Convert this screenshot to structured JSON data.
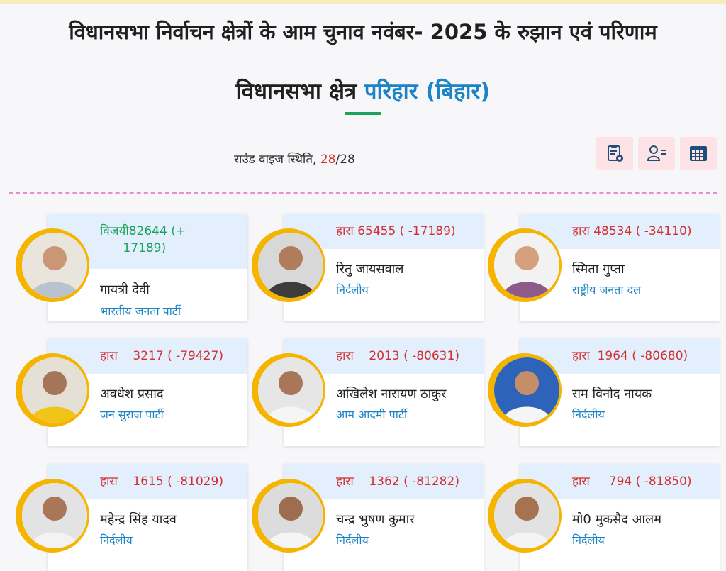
{
  "header": {
    "title": "विधानसभा निर्वाचन क्षेत्रों के आम चुनाव नवंबर- 2025 के रुझान एवं परिणाम",
    "subtitle_prefix": "विधानसभा क्षेत्र ",
    "constituency": "परिहार",
    "state": "(बिहार)"
  },
  "round": {
    "label": "राउंड वाइज स्थिति, ",
    "current": "28",
    "total": "/28"
  },
  "toolbar": {
    "icons": [
      "clipboard-report-icon",
      "candidate-list-icon",
      "table-grid-icon"
    ]
  },
  "colors": {
    "won": "#19a45a",
    "lost": "#d32f2f",
    "party": "#1c84c6",
    "card_header": "#e3effc",
    "avatar_ring": "#f4b400",
    "toolbar_bg": "#fde3e6"
  },
  "candidates": [
    {
      "status": "विजयी82644 (+\n      17189)",
      "name": "गायत्री देवी",
      "party": "भारतीय जनता पार्टी",
      "won": true
    },
    {
      "status": "हारा 65455 ( -17189)",
      "name": "रितु जायसवाल",
      "party": "निर्दलीय",
      "won": false
    },
    {
      "status": "हारा 48534 ( -34110)",
      "name": "स्मिता गुप्ता",
      "party": "राष्ट्रीय जनता दल",
      "won": false
    },
    {
      "status": "हारा    3217 ( -79427)",
      "name": "अवधेश प्रसाद",
      "party": "जन सुराज पार्टी",
      "won": false
    },
    {
      "status": "हारा    2013 ( -80631)",
      "name": "अखिलेश नारायण ठाकुर",
      "party": "आम आदमी पार्टी",
      "won": false
    },
    {
      "status": "हारा  1964 ( -80680)",
      "name": "राम विनोद नायक",
      "party": "निर्दलीय",
      "won": false
    },
    {
      "status": "हारा    1615 ( -81029)",
      "name": "महेन्द्र सिंह यादव",
      "party": "निर्दलीय",
      "won": false
    },
    {
      "status": "हारा    1362 ( -81282)",
      "name": "चन्द्र भुषण कुमार",
      "party": "निर्दलीय",
      "won": false
    },
    {
      "status": "हारा     794 ( -81850)",
      "name": "मो0 मुकसैद आलम",
      "party": "निर्दलीय",
      "won": false
    }
  ]
}
